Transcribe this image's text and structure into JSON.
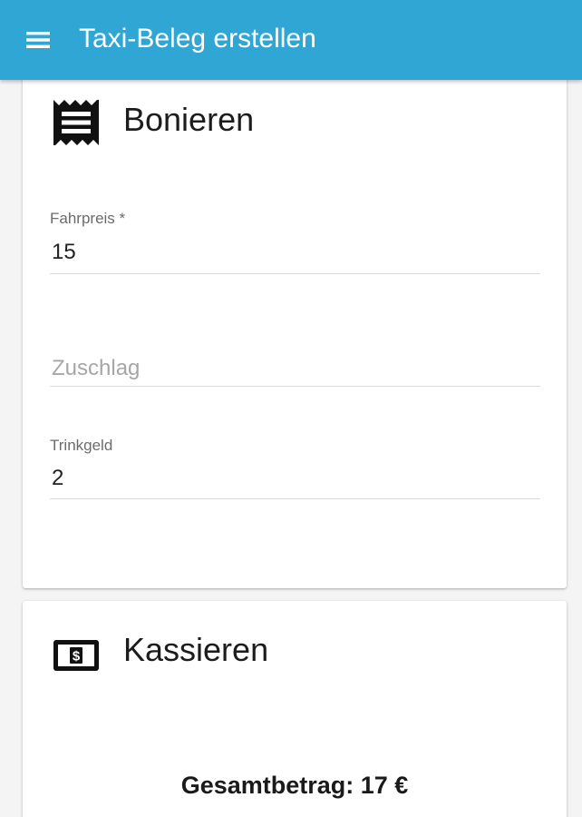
{
  "appbar": {
    "title": "Taxi-Beleg erstellen",
    "color": "#2fa6d4",
    "menu_icon": "menu-icon"
  },
  "bonieren": {
    "title": "Bonieren",
    "icon": "receipt-icon",
    "fields": {
      "fahrpreis": {
        "label": "Fahrpreis *",
        "value": "15"
      },
      "zuschlag": {
        "placeholder": "Zuschlag",
        "value": ""
      },
      "trinkgeld": {
        "label": "Trinkgeld",
        "value": "2"
      }
    }
  },
  "kassieren": {
    "title": "Kassieren",
    "icon": "cash-icon",
    "total": "Gesamtbetrag: 17 €"
  }
}
